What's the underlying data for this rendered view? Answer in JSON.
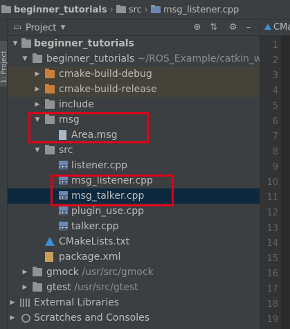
{
  "breadcrumb": {
    "project": "beginner_tutorials",
    "folder": "src",
    "file": "msg_listener.cpp"
  },
  "tool_window_tab": "1: Project",
  "panel": {
    "title": "Project"
  },
  "tree": [
    {
      "label": "beginner_tutorials",
      "bold": true
    },
    {
      "label": "beginner_tutorials",
      "path": "~/ROS_Example/catkin_w"
    },
    {
      "label": "cmake-build-debug"
    },
    {
      "label": "cmake-build-release"
    },
    {
      "label": "include"
    },
    {
      "label": "msg"
    },
    {
      "label": "Area.msg"
    },
    {
      "label": "src"
    },
    {
      "label": "listener.cpp"
    },
    {
      "label": "msg_listener.cpp"
    },
    {
      "label": "msg_talker.cpp"
    },
    {
      "label": "plugin_use.cpp"
    },
    {
      "label": "talker.cpp"
    },
    {
      "label": "CMakeLists.txt"
    },
    {
      "label": "package.xml"
    },
    {
      "label": "gmock",
      "path": "/usr/src/gmock"
    },
    {
      "label": "gtest",
      "path": "/usr/src/gtest"
    },
    {
      "label": "External Libraries"
    },
    {
      "label": "Scratches and Consoles"
    }
  ],
  "editor": {
    "tab_label": "CMakeLists.txt",
    "line_numbers": [
      "1",
      "2",
      "3",
      "4",
      "5",
      "6",
      "7",
      "8",
      "9",
      "10",
      "11",
      "12",
      "13",
      "14",
      "15",
      "16",
      "17",
      "18",
      "19"
    ]
  }
}
